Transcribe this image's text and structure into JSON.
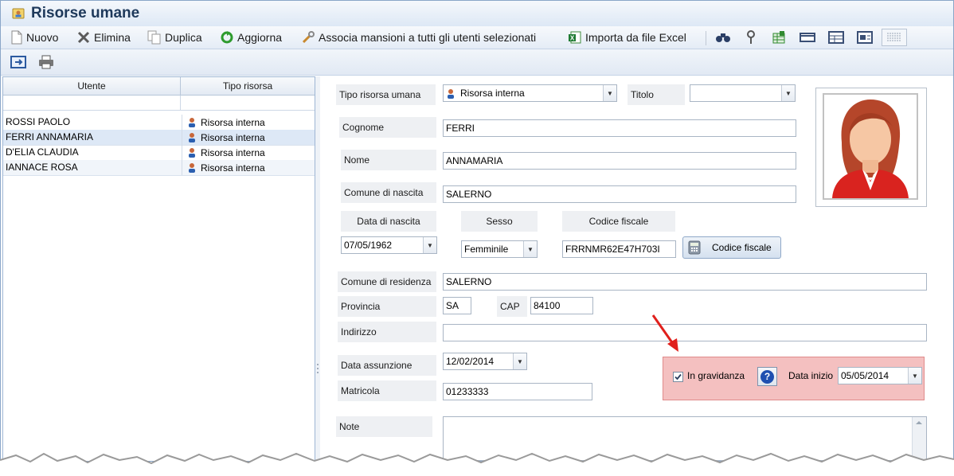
{
  "title": "Risorse umane",
  "toolbar": {
    "new_label": "Nuovo",
    "delete_label": "Elimina",
    "duplicate_label": "Duplica",
    "refresh_label": "Aggiorna",
    "assign_label": "Associa mansioni a tutti gli utenti selezionati",
    "import_label": "Importa da file Excel"
  },
  "grid": {
    "columns": [
      "Utente",
      "Tipo risorsa"
    ],
    "rows": [
      {
        "utente": "ROSSI PAOLO",
        "tipo": "Risorsa interna"
      },
      {
        "utente": "FERRI ANNAMARIA",
        "tipo": "Risorsa interna"
      },
      {
        "utente": "D'ELIA CLAUDIA",
        "tipo": "Risorsa interna"
      },
      {
        "utente": "IANNACE ROSA",
        "tipo": "Risorsa interna"
      }
    ],
    "selected_index": 1
  },
  "form": {
    "tipo_risorsa_label": "Tipo risorsa umana",
    "tipo_risorsa_value": "Risorsa interna",
    "titolo_label": "Titolo",
    "titolo_value": "",
    "cognome_label": "Cognome",
    "cognome_value": "FERRI",
    "nome_label": "Nome",
    "nome_value": "ANNAMARIA",
    "comune_nascita_label": "Comune di nascita",
    "comune_nascita_value": "SALERNO",
    "data_nascita_label": "Data di nascita",
    "data_nascita_value": "07/05/1962",
    "sesso_label": "Sesso",
    "sesso_value": "Femminile",
    "codice_fiscale_label": "Codice fiscale",
    "codice_fiscale_value": "FRRNMR62E47H703I",
    "codice_fiscale_button": "Codice fiscale",
    "comune_residenza_label": "Comune di residenza",
    "comune_residenza_value": "SALERNO",
    "provincia_label": "Provincia",
    "provincia_value": "SA",
    "cap_label": "CAP",
    "cap_value": "84100",
    "indirizzo_label": "Indirizzo",
    "indirizzo_value": "",
    "data_assunzione_label": "Data assunzione",
    "data_assunzione_value": "12/02/2014",
    "matricola_label": "Matricola",
    "matricola_value": "01233333",
    "note_label": "Note",
    "gravidanza_label": "In gravidanza",
    "gravidanza_checked": true,
    "data_inizio_label": "Data inizio",
    "data_inizio_value": "05/05/2014"
  },
  "colors": {
    "highlight_box": "#f4c0c0",
    "arrow": "#e0201c",
    "title_text": "#1e395b"
  },
  "icons": [
    "new-icon",
    "delete-icon",
    "duplicate-icon",
    "refresh-icon",
    "wrench-icon",
    "excel-icon",
    "binoculars-icon",
    "filter-icon",
    "columns-icon",
    "layout-icons",
    "export-icon",
    "print-icon",
    "person-icon",
    "female-avatar",
    "help-icon",
    "calculator-icon"
  ]
}
